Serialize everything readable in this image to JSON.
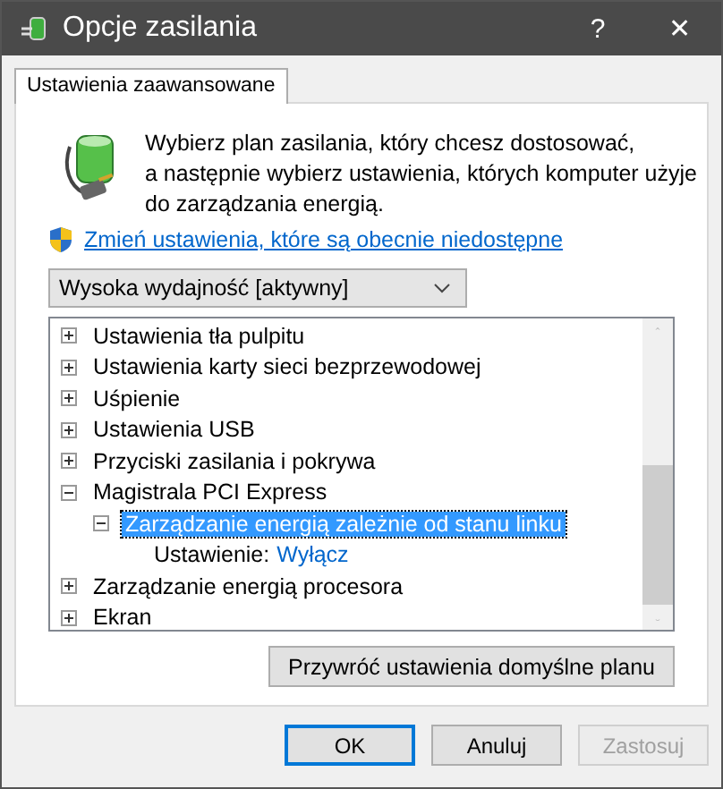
{
  "window": {
    "title": "Opcje zasilania",
    "help": "?",
    "close": "✕"
  },
  "tabs": [
    {
      "label": "Ustawienia zaawansowane",
      "selected": true
    }
  ],
  "description": [
    "Wybierz plan zasilania, który chcesz dostosować,",
    "a następnie wybierz ustawienia, których komputer użyje",
    "do zarządzania energią."
  ],
  "link": "Zmień ustawienia, które są obecnie niedostępne",
  "plan_dropdown": {
    "value": "Wysoka wydajność [aktywny]"
  },
  "tree": [
    {
      "label": "Ustawienia tła pulpitu",
      "expanded": false,
      "selected": false
    },
    {
      "label": "Ustawienia karty sieci bezprzewodowej",
      "expanded": false,
      "selected": false
    },
    {
      "label": "Uśpienie",
      "expanded": false,
      "selected": false
    },
    {
      "label": "Ustawienia USB",
      "expanded": false,
      "selected": false
    },
    {
      "label": "Przyciski zasilania i pokrywa",
      "expanded": false,
      "selected": false
    },
    {
      "label": "Magistrala PCI Express",
      "expanded": true,
      "selected": false,
      "children": [
        {
          "label": "Zarządzanie energią zależnie od stanu linku",
          "expanded": true,
          "selected": true,
          "children": [
            {
              "kind": "setting",
              "label": "Ustawienie:",
              "value": "Wyłącz"
            }
          ]
        }
      ]
    },
    {
      "label": "Zarządzanie energią procesora",
      "expanded": false,
      "selected": false
    },
    {
      "label": "Ekran",
      "expanded": false,
      "selected": false
    }
  ],
  "restore_button": "Przywróć ustawienia domyślne planu",
  "buttons": [
    {
      "label": "OK",
      "default": true,
      "disabled": false
    },
    {
      "label": "Anuluj",
      "default": false,
      "disabled": false
    },
    {
      "label": "Zastosuj",
      "default": false,
      "disabled": true
    }
  ]
}
